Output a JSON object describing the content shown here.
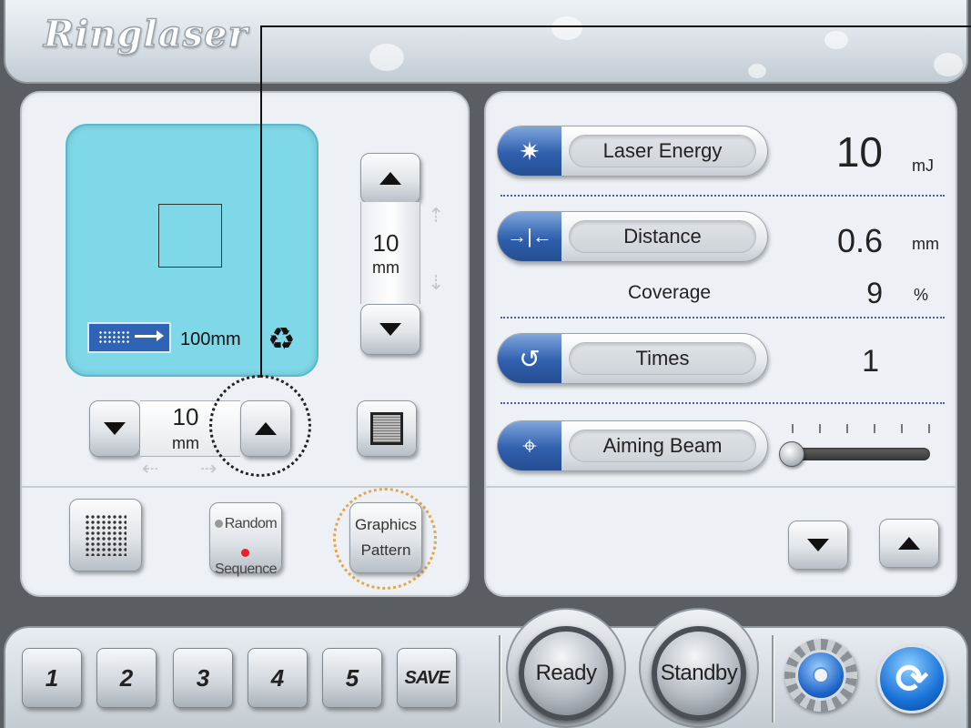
{
  "header": {
    "logo_text": "Ringlaser"
  },
  "preview": {
    "scan_length": "100mm",
    "reset_glyph": "♻"
  },
  "vertical_stepper": {
    "value": "10",
    "unit": "mm"
  },
  "horizontal_stepper": {
    "value": "10",
    "unit": "mm"
  },
  "mode_buttons": {
    "random_label": "Random",
    "sequence_label": "Sequence",
    "graphics_label": "Graphics",
    "pattern_label": "Pattern"
  },
  "parameters": {
    "laser_energy": {
      "label": "Laser  Energy",
      "value": "10",
      "unit": "mJ"
    },
    "distance": {
      "label": "Distance",
      "value": "0.6",
      "unit": "mm"
    },
    "coverage": {
      "label": "Coverage",
      "value": "9",
      "unit": "%"
    },
    "times": {
      "label": "Times",
      "value": "1"
    },
    "aiming_beam": {
      "label": "Aiming Beam",
      "level": 0
    }
  },
  "presets": [
    "1",
    "2",
    "3",
    "4",
    "5"
  ],
  "save_label": "SAVE",
  "ready_label": "Ready",
  "standby_label": "Standby",
  "icons": {
    "laser_energy": "laser-energy-icon",
    "distance": "distance-icon",
    "times": "repeat-icon",
    "aiming_beam": "crosshair-icon",
    "settings": "gear-icon",
    "refresh": "refresh-icon"
  },
  "colors": {
    "preview_bg": "#7fd8e8",
    "accent_blue": "#2f5fae",
    "sequence_dot": "#e8202a",
    "random_dot": "#999999",
    "highlight_ring": "#e0a84a"
  }
}
